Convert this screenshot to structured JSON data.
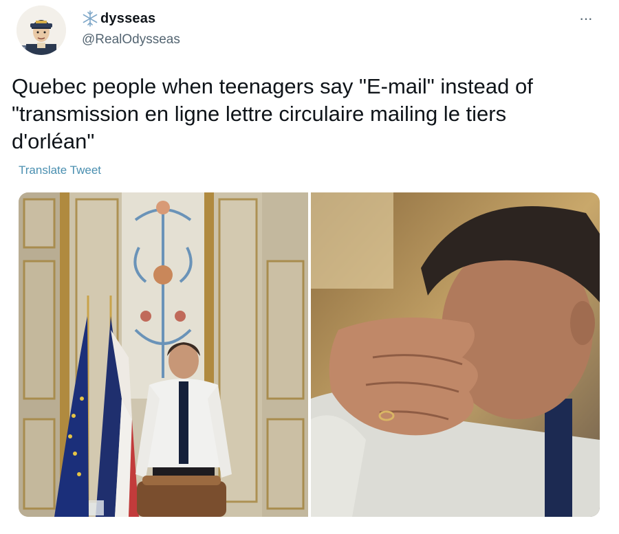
{
  "author": {
    "display_name": "dysseas",
    "handle": "@RealOdysseas",
    "badge_icon": "snowflake-icon",
    "avatar_icon": "cartoon-captain-avatar"
  },
  "menu_icon": "more-options-icon",
  "tweet": {
    "text": "Quebec people when teenagers say \"E-mail\" instead of\n\"transmission en ligne lettre circulaire mailing le tiers\nd'orléan\"",
    "translate_label": "Translate Tweet"
  },
  "media": {
    "left_photo": "man-leaning-over-desk-with-flags",
    "right_photo": "man-covering-face-with-hands"
  },
  "colors": {
    "text": "#0f1419",
    "secondary_text": "#536471",
    "link": "#4a8fb0",
    "flag_blue": "#1f2f6e",
    "flag_red": "#c23b3b",
    "eu_blue": "#1b2f7a",
    "gold": "#d6b24a"
  }
}
